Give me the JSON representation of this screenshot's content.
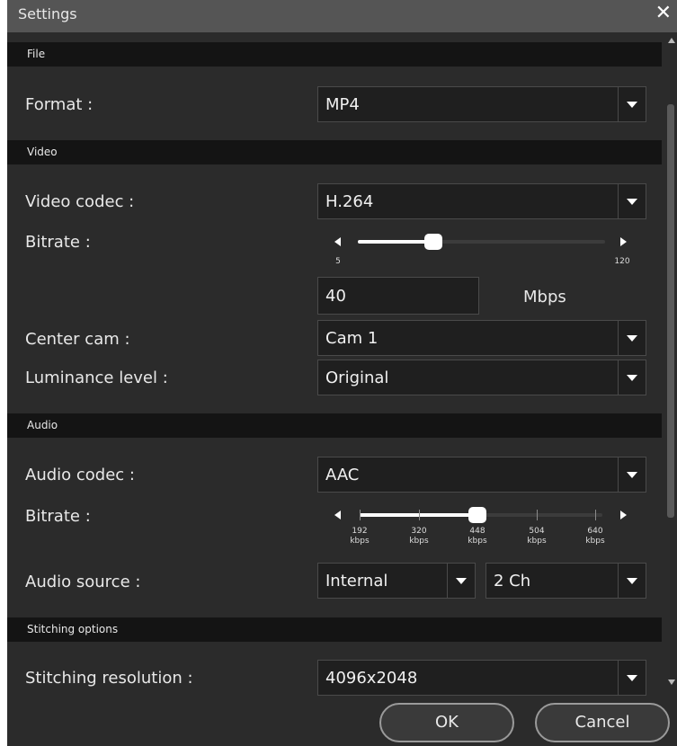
{
  "window": {
    "title": "Settings",
    "close_glyph": "✕"
  },
  "file": {
    "header": "File",
    "format": {
      "label": "Format :",
      "value": "MP4"
    }
  },
  "video": {
    "header": "Video",
    "codec": {
      "label": "Video codec :",
      "value": "H.264"
    },
    "bitrate": {
      "label": "Bitrate :",
      "min_label": "5",
      "max_label": "120",
      "value": "40",
      "unit": "Mbps",
      "min": 5,
      "max": 120,
      "level": 40
    },
    "center_cam": {
      "label": "Center cam :",
      "value": "Cam 1"
    },
    "luminance": {
      "label": "Luminance level :",
      "value": "Original"
    }
  },
  "audio": {
    "header": "Audio",
    "codec": {
      "label": "Audio codec :",
      "value": "AAC"
    },
    "bitrate": {
      "label": "Bitrate :",
      "ticks": [
        {
          "value": "192",
          "unit": "kbps"
        },
        {
          "value": "320",
          "unit": "kbps"
        },
        {
          "value": "448",
          "unit": "kbps"
        },
        {
          "value": "504",
          "unit": "kbps"
        },
        {
          "value": "640",
          "unit": "kbps"
        }
      ],
      "selected": "448"
    },
    "source": {
      "label": "Audio source :",
      "value": "Internal",
      "channels": "2 Ch"
    }
  },
  "stitching": {
    "header": "Stitching options",
    "resolution": {
      "label": "Stitching resolution :",
      "value": "4096x2048"
    }
  },
  "buttons": {
    "ok": "OK",
    "cancel": "Cancel"
  },
  "colors": {
    "background": "#2b2b2b",
    "section_header": "#141414",
    "titlebar": "#555555",
    "control": "#1f1f1f",
    "text": "#e8e8e8"
  }
}
